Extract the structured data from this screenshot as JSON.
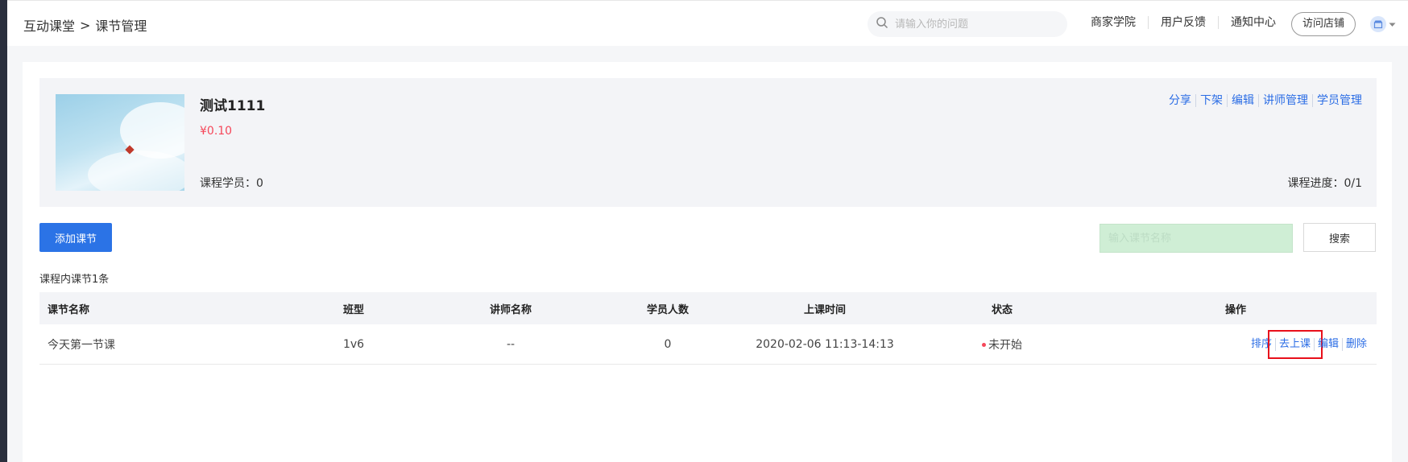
{
  "breadcrumb": {
    "root": "互动课堂",
    "separator": ">",
    "current": "课节管理"
  },
  "header": {
    "search_placeholder": "请输入你的问题",
    "links": [
      "商家学院",
      "用户反馈",
      "通知中心"
    ],
    "visit_store": "访问店铺"
  },
  "course": {
    "title": "测试1111",
    "price": "¥0.10",
    "students": "课程学员：0",
    "progress": "课程进度：0/1",
    "actions": [
      "分享",
      "下架",
      "编辑",
      "讲师管理",
      "学员管理"
    ]
  },
  "toolbar": {
    "add_label": "添加课节",
    "search_placeholder": "输入课节名称",
    "search_label": "搜索"
  },
  "count_text": "课程内课节1条",
  "table": {
    "headers": [
      "课节名称",
      "班型",
      "讲师名称",
      "学员人数",
      "上课时间",
      "状态",
      "操作"
    ],
    "rows": [
      {
        "name": "今天第一节课",
        "class_type": "1v6",
        "teacher": "--",
        "students": "0",
        "time": "2020-02-06 11:13-14:13",
        "status": "未开始",
        "ops": [
          "排序",
          "去上课",
          "编辑",
          "删除"
        ]
      }
    ]
  },
  "colors": {
    "accent": "#2b73e6",
    "link": "#2b6de5",
    "price": "#f5475a",
    "highlight": "#e8101b"
  }
}
